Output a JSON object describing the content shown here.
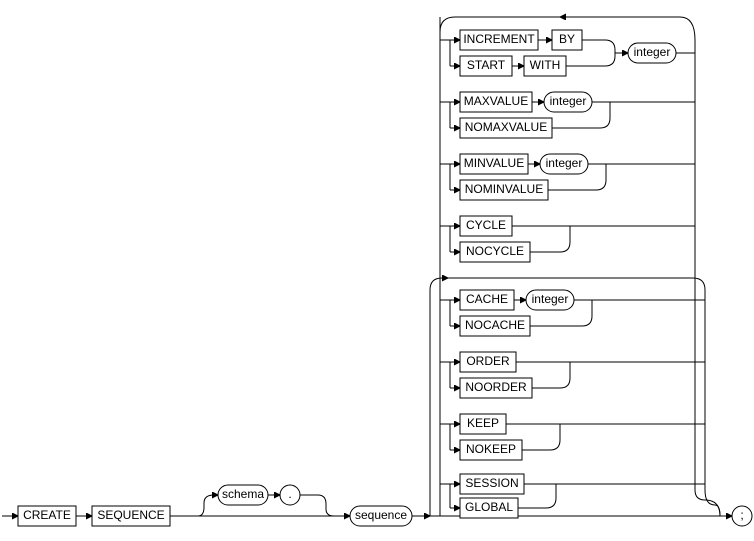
{
  "diagram": {
    "type": "railroad-syntax-diagram",
    "statement": "CREATE SEQUENCE",
    "keywords": {
      "create": "CREATE",
      "sequence_kw": "SEQUENCE",
      "schema": "schema",
      "dot": ".",
      "sequence_name": "sequence",
      "semicolon": ";",
      "increment": "INCREMENT",
      "by": "BY",
      "start": "START",
      "with": "WITH",
      "integer1": "integer",
      "maxvalue": "MAXVALUE",
      "integer2": "integer",
      "nomaxvalue": "NOMAXVALUE",
      "minvalue": "MINVALUE",
      "integer3": "integer",
      "nominvalue": "NOMINVALUE",
      "cycle": "CYCLE",
      "nocycle": "NOCYCLE",
      "cache": "CACHE",
      "integer4": "integer",
      "nocache": "NOCACHE",
      "order": "ORDER",
      "noorder": "NOORDER",
      "keep": "KEEP",
      "nokeep": "NOKEEP",
      "session": "SESSION",
      "global": "GLOBAL"
    }
  }
}
